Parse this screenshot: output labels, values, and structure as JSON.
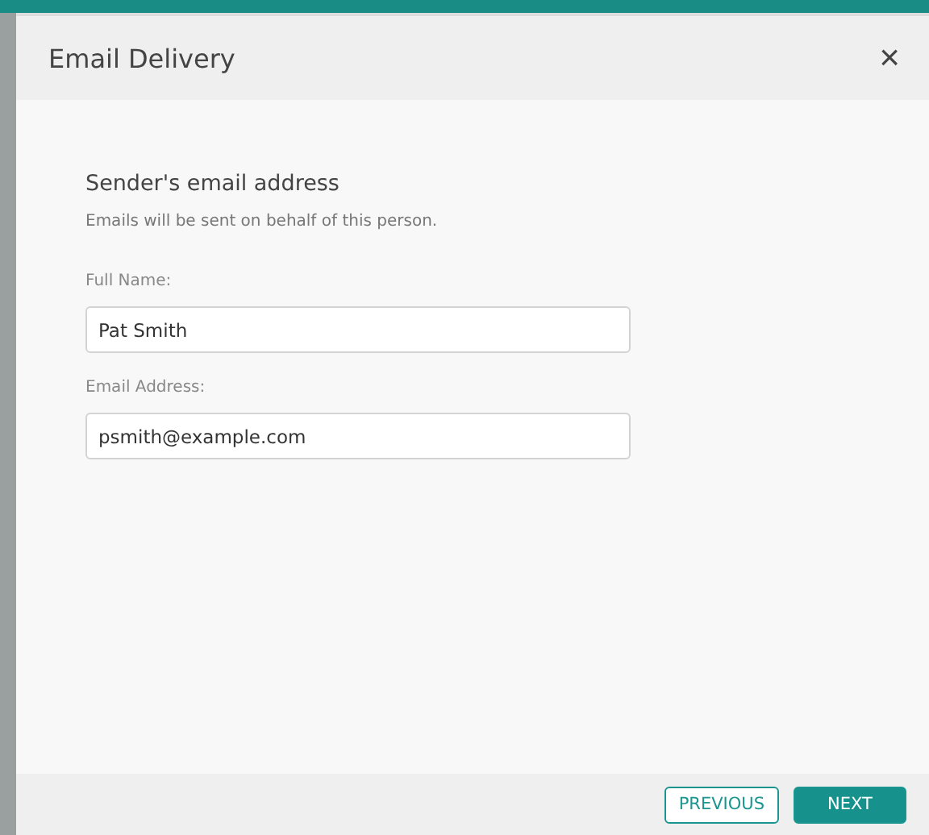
{
  "dialog": {
    "title": "Email Delivery",
    "close": "×"
  },
  "section": {
    "heading": "Sender's email address",
    "description": "Emails will be sent on behalf of this person."
  },
  "fields": [
    {
      "label": "Full Name:",
      "value": "Pat Smith"
    },
    {
      "label": "Email Address:",
      "value": "psmith@example.com"
    }
  ],
  "buttons": [
    {
      "label": "PREVIOUS",
      "kind": "secondary"
    },
    {
      "label": "NEXT",
      "kind": "primary"
    }
  ]
}
